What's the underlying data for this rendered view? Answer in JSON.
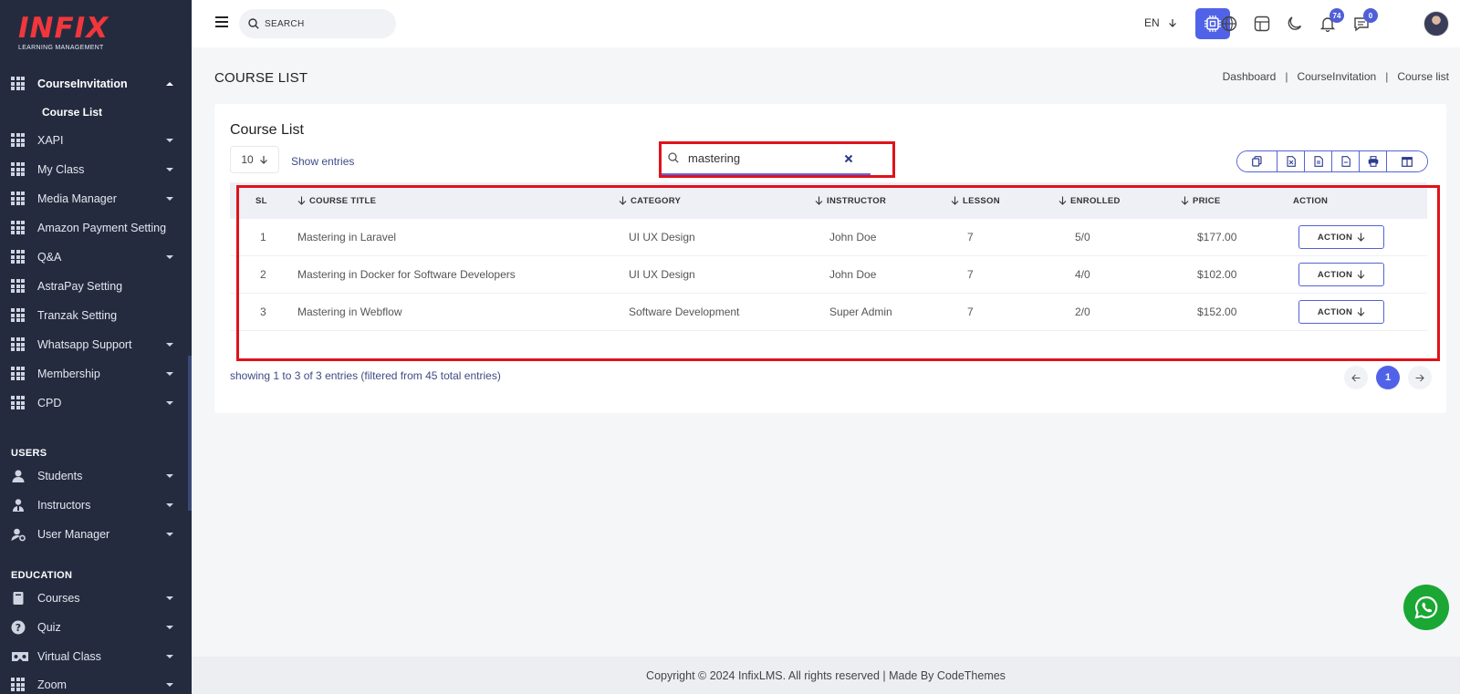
{
  "sidebar": {
    "logo_text": "INFIX",
    "logo_sub": "LEARNING MANAGEMENT",
    "items": [
      {
        "label": "CourseInvitation",
        "icon": "grid-icon",
        "expanded": true
      },
      {
        "label": "XAPI",
        "icon": "grid-icon"
      },
      {
        "label": "My Class",
        "icon": "grid-icon"
      },
      {
        "label": "Media Manager",
        "icon": "grid-icon"
      },
      {
        "label": "Amazon Payment Setting",
        "icon": "grid-icon"
      },
      {
        "label": "Q&A",
        "icon": "grid-icon"
      },
      {
        "label": "AstraPay Setting",
        "icon": "grid-icon"
      },
      {
        "label": "Tranzak Setting",
        "icon": "grid-icon"
      },
      {
        "label": "Whatsapp Support",
        "icon": "grid-icon"
      },
      {
        "label": "Membership",
        "icon": "grid-icon"
      },
      {
        "label": "CPD",
        "icon": "grid-icon"
      }
    ],
    "sub_item": "Course List",
    "users_title": "USERS",
    "users_items": [
      {
        "label": "Students",
        "icon": "user-icon"
      },
      {
        "label": "Instructors",
        "icon": "instructor-icon"
      },
      {
        "label": "User Manager",
        "icon": "user-gear-icon"
      }
    ],
    "education_title": "EDUCATION",
    "education_items": [
      {
        "label": "Courses",
        "icon": "book-icon"
      },
      {
        "label": "Quiz",
        "icon": "question-icon"
      },
      {
        "label": "Virtual Class",
        "icon": "vr-icon"
      },
      {
        "label": "Zoom",
        "icon": "grid-icon"
      }
    ]
  },
  "header": {
    "search_placeholder": "SEARCH",
    "language": "EN",
    "notifications_count": "74",
    "messages_count": "0"
  },
  "page": {
    "title": "COURSE LIST",
    "breadcrumb": [
      "Dashboard",
      "CourseInvitation",
      "Course list"
    ]
  },
  "card": {
    "title": "Course List",
    "entries_value": "10",
    "show_entries": "Show entries",
    "search_value": "mastering",
    "columns": [
      "SL",
      "COURSE TITLE",
      "CATEGORY",
      "INSTRUCTOR",
      "LESSON",
      "ENROLLED",
      "PRICE",
      "ACTION"
    ],
    "rows": [
      {
        "sl": "1",
        "title": "Mastering in Laravel",
        "category": "UI UX Design",
        "instructor": "John Doe",
        "lesson": "7",
        "enrolled": "5/0",
        "price": "$177.00",
        "action": "ACTION"
      },
      {
        "sl": "2",
        "title": "Mastering in Docker for Software Developers",
        "category": "UI UX Design",
        "instructor": "John Doe",
        "lesson": "7",
        "enrolled": "4/0",
        "price": "$102.00",
        "action": "ACTION"
      },
      {
        "sl": "3",
        "title": "Mastering in Webflow",
        "category": "Software Development",
        "instructor": "Super Admin",
        "lesson": "7",
        "enrolled": "2/0",
        "price": "$152.00",
        "action": "ACTION"
      }
    ],
    "showing_text": "showing 1 to 3 of 3 entries (filtered from 45 total entries)",
    "current_page": "1"
  },
  "footer": {
    "text": "Copyright © 2024 InfixLMS. All rights reserved | Made By CodeThemes"
  },
  "colors": {
    "sidebar_bg": "#242b3f",
    "accent": "#5063e8",
    "highlight_red": "#e0121a",
    "whatsapp_green": "#1aa733"
  }
}
